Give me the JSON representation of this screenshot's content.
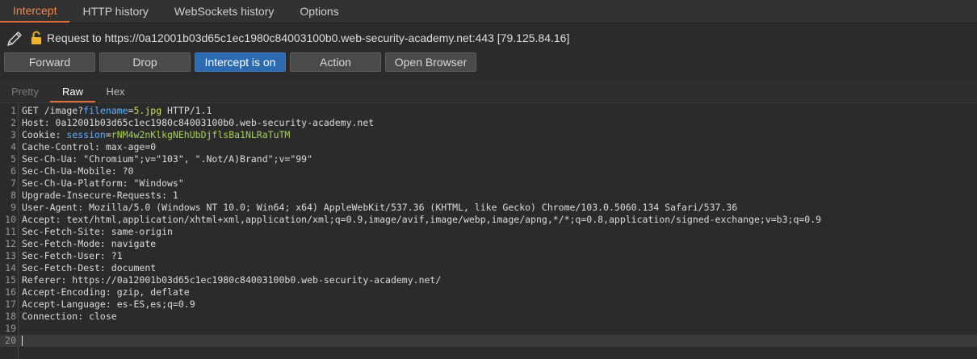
{
  "tabs": [
    {
      "label": "Intercept",
      "active": true
    },
    {
      "label": "HTTP history",
      "active": false
    },
    {
      "label": "WebSockets history",
      "active": false
    },
    {
      "label": "Options",
      "active": false
    }
  ],
  "request_info": "Request to https://0a12001b03d65c1ec1980c84003100b0.web-security-academy.net:443  [79.125.84.16]",
  "buttons": {
    "forward": "Forward",
    "drop": "Drop",
    "intercept": "Intercept is on",
    "action": "Action",
    "open_browser": "Open Browser"
  },
  "view_tabs": [
    {
      "label": "Pretty",
      "active": false
    },
    {
      "label": "Raw",
      "active": true
    },
    {
      "label": "Hex",
      "active": false
    }
  ],
  "colors": {
    "accent": "#e0703a",
    "primary_button": "#2d6bb0",
    "param_name": "#5fb0ff",
    "param_value": "#c8e05a"
  },
  "icons": [
    "pencil-icon",
    "lock-icon"
  ],
  "request_lines": [
    {
      "n": "1",
      "pre": "GET /image?",
      "param": "filename",
      "eq": "=",
      "val": "5.jpg",
      "post": " HTTP/1.1"
    },
    {
      "n": "2",
      "text": "Host: 0a12001b03d65c1ec1980c84003100b0.web-security-academy.net"
    },
    {
      "n": "3",
      "pre": "Cookie: ",
      "param": "session",
      "eq": "=",
      "val": "rNM4w2nKlkgNEhUbDjflsBa1NLRaTuTM",
      "post": ""
    },
    {
      "n": "4",
      "text": "Cache-Control: max-age=0"
    },
    {
      "n": "5",
      "text": "Sec-Ch-Ua: \"Chromium\";v=\"103\", \".Not/A)Brand\";v=\"99\""
    },
    {
      "n": "6",
      "text": "Sec-Ch-Ua-Mobile: ?0"
    },
    {
      "n": "7",
      "text": "Sec-Ch-Ua-Platform: \"Windows\""
    },
    {
      "n": "8",
      "text": "Upgrade-Insecure-Requests: 1"
    },
    {
      "n": "9",
      "text": "User-Agent: Mozilla/5.0 (Windows NT 10.0; Win64; x64) AppleWebKit/537.36 (KHTML, like Gecko) Chrome/103.0.5060.134 Safari/537.36"
    },
    {
      "n": "10",
      "text": "Accept: text/html,application/xhtml+xml,application/xml;q=0.9,image/avif,image/webp,image/apng,*/*;q=0.8,application/signed-exchange;v=b3;q=0.9"
    },
    {
      "n": "11",
      "text": "Sec-Fetch-Site: same-origin"
    },
    {
      "n": "12",
      "text": "Sec-Fetch-Mode: navigate"
    },
    {
      "n": "13",
      "text": "Sec-Fetch-User: ?1"
    },
    {
      "n": "14",
      "text": "Sec-Fetch-Dest: document"
    },
    {
      "n": "15",
      "text": "Referer: https://0a12001b03d65c1ec1980c84003100b0.web-security-academy.net/"
    },
    {
      "n": "16",
      "text": "Accept-Encoding: gzip, deflate"
    },
    {
      "n": "17",
      "text": "Accept-Language: es-ES,es;q=0.9"
    },
    {
      "n": "18",
      "text": "Connection: close"
    },
    {
      "n": "19",
      "text": ""
    },
    {
      "n": "20",
      "text": ""
    }
  ]
}
